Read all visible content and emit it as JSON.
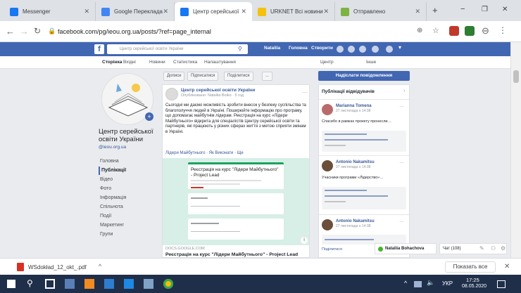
{
  "browser": {
    "tabs": [
      {
        "label": "Messenger",
        "color": "#1877f2"
      },
      {
        "label": "Google Перекладач",
        "color": "#4285f4"
      },
      {
        "label": "Центр серейської о",
        "color": "#1877f2"
      },
      {
        "label": "URKNET Всі новини",
        "color": "#f4c20d"
      },
      {
        "label": "Отправлено",
        "color": "#7cb342"
      }
    ],
    "url": "facebook.com/pg/ieou.org.ua/posts/?ref=page_internal",
    "new_tab": "+",
    "win_min": "−",
    "win_max": "❐",
    "win_close": "✕"
  },
  "fb": {
    "search_placeholder": "Центр серейської освіти України",
    "nav": [
      "Nataliia",
      "Головна",
      "Створити"
    ],
    "subnav": [
      "Сторінка",
      "Вхідні",
      "Новини",
      "Статистика",
      "Налаштування",
      "Центр",
      "Інше"
    ],
    "page_name": "Центр серейської освіти України",
    "page_handle": "@ieou.org.ua",
    "sidebar": [
      "Головна",
      "Публікації",
      "Відео",
      "Фото",
      "Інформація",
      "Спільнота",
      "Події",
      "Маркетинг",
      "Групи"
    ],
    "sidebar_selected": 1,
    "post_tabs": [
      "Дописи",
      "Підписатися",
      "Поділитися",
      "..."
    ],
    "post_author": "Центр серейської освіти України",
    "post_meta": "Опубліковано: Nataliia Boiko · 5 год",
    "post_text": "Сьогодні ми даємо можливість зробити внесок у безпеку суспільства та благополуччя людей в Україні. Поширюйте інформацію про програму, що допомагає майбутнім лідерам. Реєстрація на курс «Лідери Майбутнього» відкрита для спеціалістів Центру серейської освіти та партнерів, які працюють у різних сферах життя з метою сприяти змінам в Україні.",
    "post_footer": "Лідери Майбутнього · Як Виконати · Ще",
    "form_title": "Реєстрація на курс \"Лідери Майбутнього\" - Project Lead",
    "link_domain": "DOCS.GOOGLE.COM",
    "link_title": "Реєстрація на курс \"Лідери Майбутнього\" - Project Lead",
    "send_message": "Надіслати повідомлення",
    "right_title": "Публікації відвідувачів",
    "visitors": [
      {
        "name": "Marianna Tomena",
        "time": "27 листопада о 14:38",
        "text": "Спасибо в рамках проекту пронесли…"
      },
      {
        "name": "Antonio Nakamitsu",
        "time": "27 листопада о 14:38",
        "text": "Учасники програми «Лідерство»…"
      },
      {
        "name": "Antonio Nakamitsu",
        "time": "27 листопада о 14:38",
        "text": "Поділитися"
      }
    ],
    "chat_name": "Nataliia Bohachova",
    "chat_count": "Чат (108)"
  },
  "download": {
    "file": "WSdokład_12_okt_.pdf",
    "show_all": "Показать все"
  },
  "taskbar": {
    "lang": "УКР",
    "time": "17:25",
    "date": "08.05.2020"
  }
}
